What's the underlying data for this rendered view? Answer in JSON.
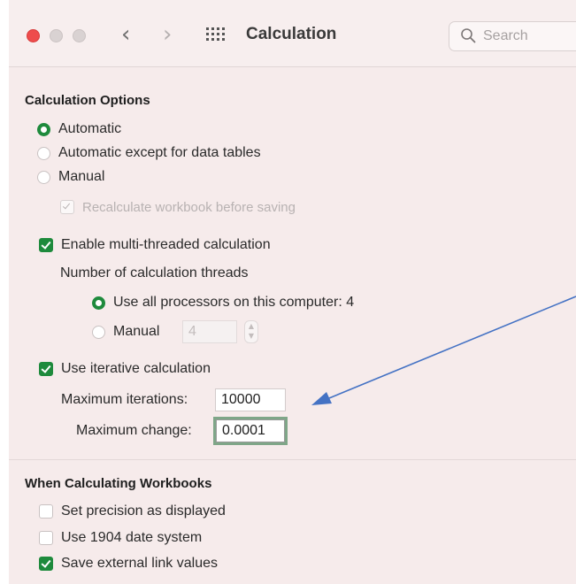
{
  "window": {
    "title": "Calculation",
    "nav_back": "‹",
    "nav_forward": "›",
    "search_placeholder": "Search"
  },
  "calculation_options": {
    "heading": "Calculation Options",
    "mode_options": [
      {
        "label": "Automatic",
        "selected": true
      },
      {
        "label": "Automatic except for data tables",
        "selected": false
      },
      {
        "label": "Manual",
        "selected": false
      }
    ],
    "recalculate_before_saving": {
      "label": "Recalculate workbook before saving",
      "checked": true,
      "enabled": false
    },
    "multithreaded": {
      "label": "Enable multi-threaded calculation",
      "checked": true
    },
    "threads_label": "Number of calculation threads",
    "thread_options": {
      "all_processors": {
        "label": "Use all processors on this computer: 4",
        "selected": true
      },
      "manual": {
        "label": "Manual",
        "selected": false,
        "value": "4"
      }
    },
    "iterative": {
      "label": "Use iterative calculation",
      "checked": true
    },
    "max_iterations": {
      "label": "Maximum iterations:",
      "value": "10000"
    },
    "max_change": {
      "label": "Maximum change:",
      "value": "0.0001"
    }
  },
  "workbooks": {
    "heading": "When Calculating Workbooks",
    "options": [
      {
        "label": "Set precision as displayed",
        "checked": false
      },
      {
        "label": "Use 1904 date system",
        "checked": false
      },
      {
        "label": "Save external link values",
        "checked": true
      }
    ]
  },
  "colors": {
    "accent": "#1e8a3c",
    "close_button": "#ee4c4c",
    "background": "#f6ebeb",
    "annotation_arrow": "#4472c4"
  }
}
